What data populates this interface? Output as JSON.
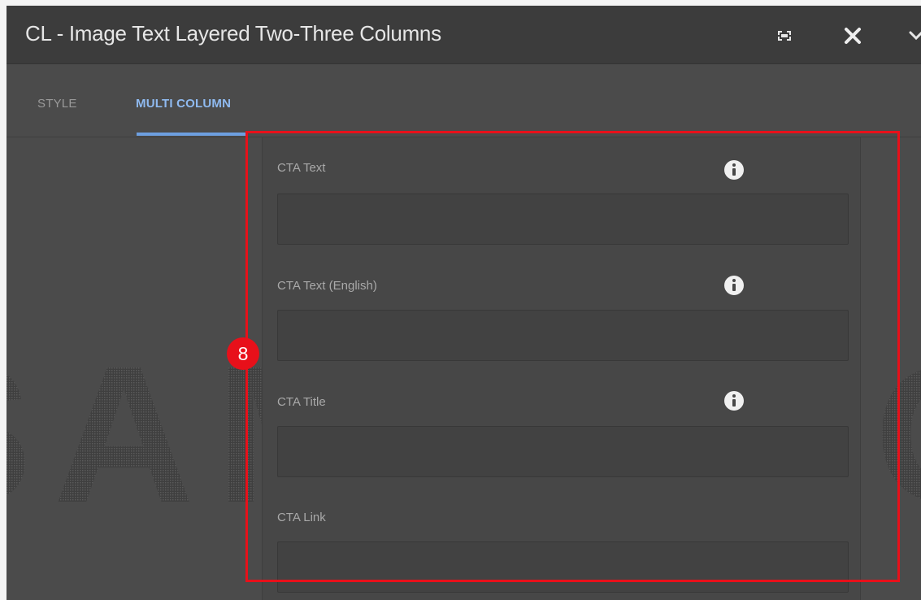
{
  "dialog": {
    "title": "CL - Image Text Layered Two-Three Columns",
    "controls": [
      {
        "name": "fullscreen",
        "icon": "fullscreen-icon"
      },
      {
        "name": "close",
        "icon": "close-icon"
      },
      {
        "name": "more",
        "icon": "chevron-down-icon"
      }
    ]
  },
  "tabs": [
    {
      "label": "STYLE",
      "active": false
    },
    {
      "label": "MULTI COLUMN",
      "active": true
    }
  ],
  "fields": [
    {
      "label": "CTA Text",
      "value": "",
      "info_icon": true
    },
    {
      "label": "CTA Text (English)",
      "value": "",
      "info_icon": true
    },
    {
      "label": "CTA Title",
      "value": "",
      "info_icon": true
    },
    {
      "label": "CTA Link",
      "value": "",
      "info_icon": false
    }
  ],
  "annotation": {
    "step_number": "8",
    "highlight_color": "#e8101a"
  },
  "watermark": {
    "text": "SAMSUNG"
  },
  "colors": {
    "title_bar": "#3c3c3c",
    "dialog_bg": "#4b4b4b",
    "active_tab": "#8fbaf0",
    "annotation_red": "#e8101a"
  }
}
